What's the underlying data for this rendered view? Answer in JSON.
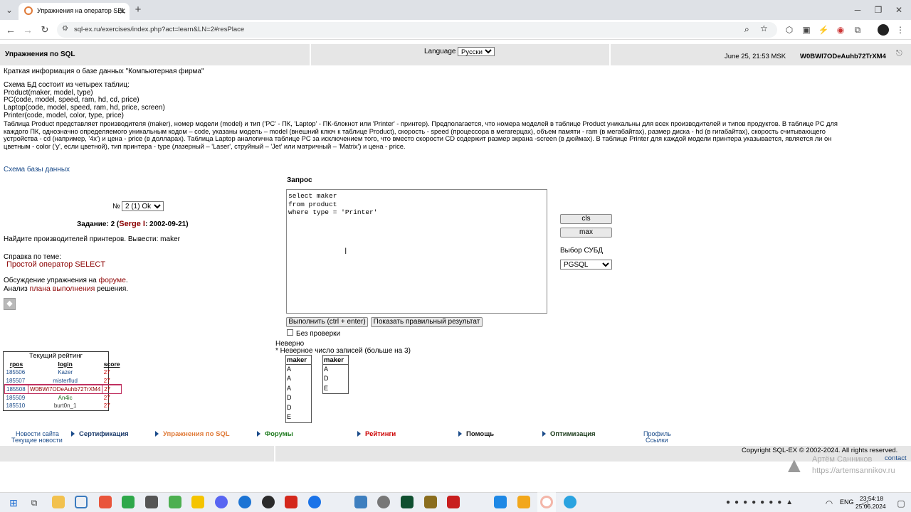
{
  "browser": {
    "tab_title": "Упражнения на оператор SEL",
    "url": "sql-ex.ru/exercises/index.php?act=learn&LN=2#resPlace"
  },
  "header": {
    "title": "Упражнения по SQL",
    "language_label": "Language",
    "language_value": "Русский",
    "datetime": "June 25, 21:53 MSK",
    "user": "W0BWI7ODeAuhb72TrXM4"
  },
  "info": {
    "line1": "Краткая информация о базе данных \"Компьютерная фирма\"",
    "schema_intro": "Схема БД состоит из четырех таблиц:",
    "tables": [
      "Product(maker, model, type)",
      "PC(code, model, speed, ram, hd, cd, price)",
      "Laptop(code, model, speed, ram, hd, price, screen)",
      "Printer(code, model, color, type, price)"
    ],
    "desc_lines": [
      "Таблица Product представляет производителя (maker), номер модели (model) и тип ('PC' - ПК, 'Laptop' - ПК-блокнот или 'Printer' - принтер). Предполагается, что номера моделей в таблице Product уникальны для всех производителей и типов продуктов. В таблице PC для",
      "каждого ПК, однозначно определяемого уникальным кодом – code, указаны модель – model (внешний ключ к таблице Product), скорость - speed (процессора в мегагерцах), объем памяти - ram (в мегабайтах), размер диска - hd (в гигабайтах), скорость считывающего",
      "устройства - cd (например, '4x') и цена - price (в долларах). Таблица Laptop аналогична таблице PC за исключением того, что вместо скорости CD содержит размер экрана -screen (в дюймах). В таблице Printer для каждой модели принтера указывается, является ли он",
      "цветным - color ('y', если цветной), тип принтера - type (лазерный – 'Laser', струйный – 'Jet' или матричный – 'Matrix') и цена - price."
    ],
    "schema_link": "Схема базы данных"
  },
  "task": {
    "num_label": "№",
    "num_value": "2 (1) Ok",
    "title_prefix": "Задание: 2 (",
    "author": "Serge I",
    "date": ": 2002-09-21)",
    "description": "Найдите производителей принтеров. Вывести: maker",
    "help_label": "Справка по теме:",
    "help_link": "Простой оператор SELECT",
    "discuss_prefix": "Обсуждение упражнения на ",
    "discuss_link": "форуме",
    "analysis_prefix": "Анализ ",
    "analysis_link": "плана выполнения",
    "analysis_suffix": " решения."
  },
  "query": {
    "label": "Запрос",
    "text": "select maker\nfrom product\nwhere type = 'Printer'",
    "run_button": "Выполнить (ctrl + enter)",
    "show_button": "Показать правильный результат",
    "no_check_label": "Без проверки",
    "cls_button": "cls",
    "max_button": "max",
    "dbms_label": "Выбор СУБД",
    "dbms_value": "PGSQL"
  },
  "result": {
    "status": "Неверно",
    "message": "* Неверное число записей (больше на 3)",
    "your_header": "maker",
    "your_rows": [
      "A",
      "A",
      "A",
      "D",
      "D",
      "E"
    ],
    "correct_header": "maker",
    "correct_rows": [
      "A",
      "D",
      "E"
    ]
  },
  "rating": {
    "title": "Текущий рейтинг",
    "columns": [
      "rpos",
      "login",
      "score"
    ],
    "rows": [
      {
        "rpos": "185506",
        "login": "Kazer",
        "score": "27"
      },
      {
        "rpos": "185507",
        "login": "misterflud",
        "score": "27"
      },
      {
        "rpos": "185508",
        "login": "W0BWI7ODeAuhb72TrXM4",
        "score": "27"
      },
      {
        "rpos": "185509",
        "login": "An4ic",
        "score": "27"
      },
      {
        "rpos": "185510",
        "login": "burt0n_1",
        "score": "27"
      }
    ]
  },
  "nav": {
    "news1": "Новости сайта",
    "news2": "Текущие новости",
    "cert": "Сертификация",
    "exercises": "Упражнения по SQL",
    "forums": "Форумы",
    "ratings": "Рейтинги",
    "help": "Помощь",
    "optimization": "Оптимизация",
    "profile": "Профиль",
    "links": "Ссылки"
  },
  "footer": {
    "copyright": "Copyright SQL-EX © 2002-2024. All rights reserved.",
    "contact": "contact",
    "watermark_name": "Артём Санников",
    "watermark_url": "https://artemsannikov.ru"
  },
  "taskbar": {
    "time": "23:54:18",
    "date": "25.06.2024",
    "lang": "ENG"
  },
  "colors": {
    "accent_orange": "#e07b39",
    "dark_red": "#8b0000",
    "link_blue": "#1a4b8a",
    "forum_green": "#1e7a1e",
    "rating_red": "#cc0000"
  }
}
